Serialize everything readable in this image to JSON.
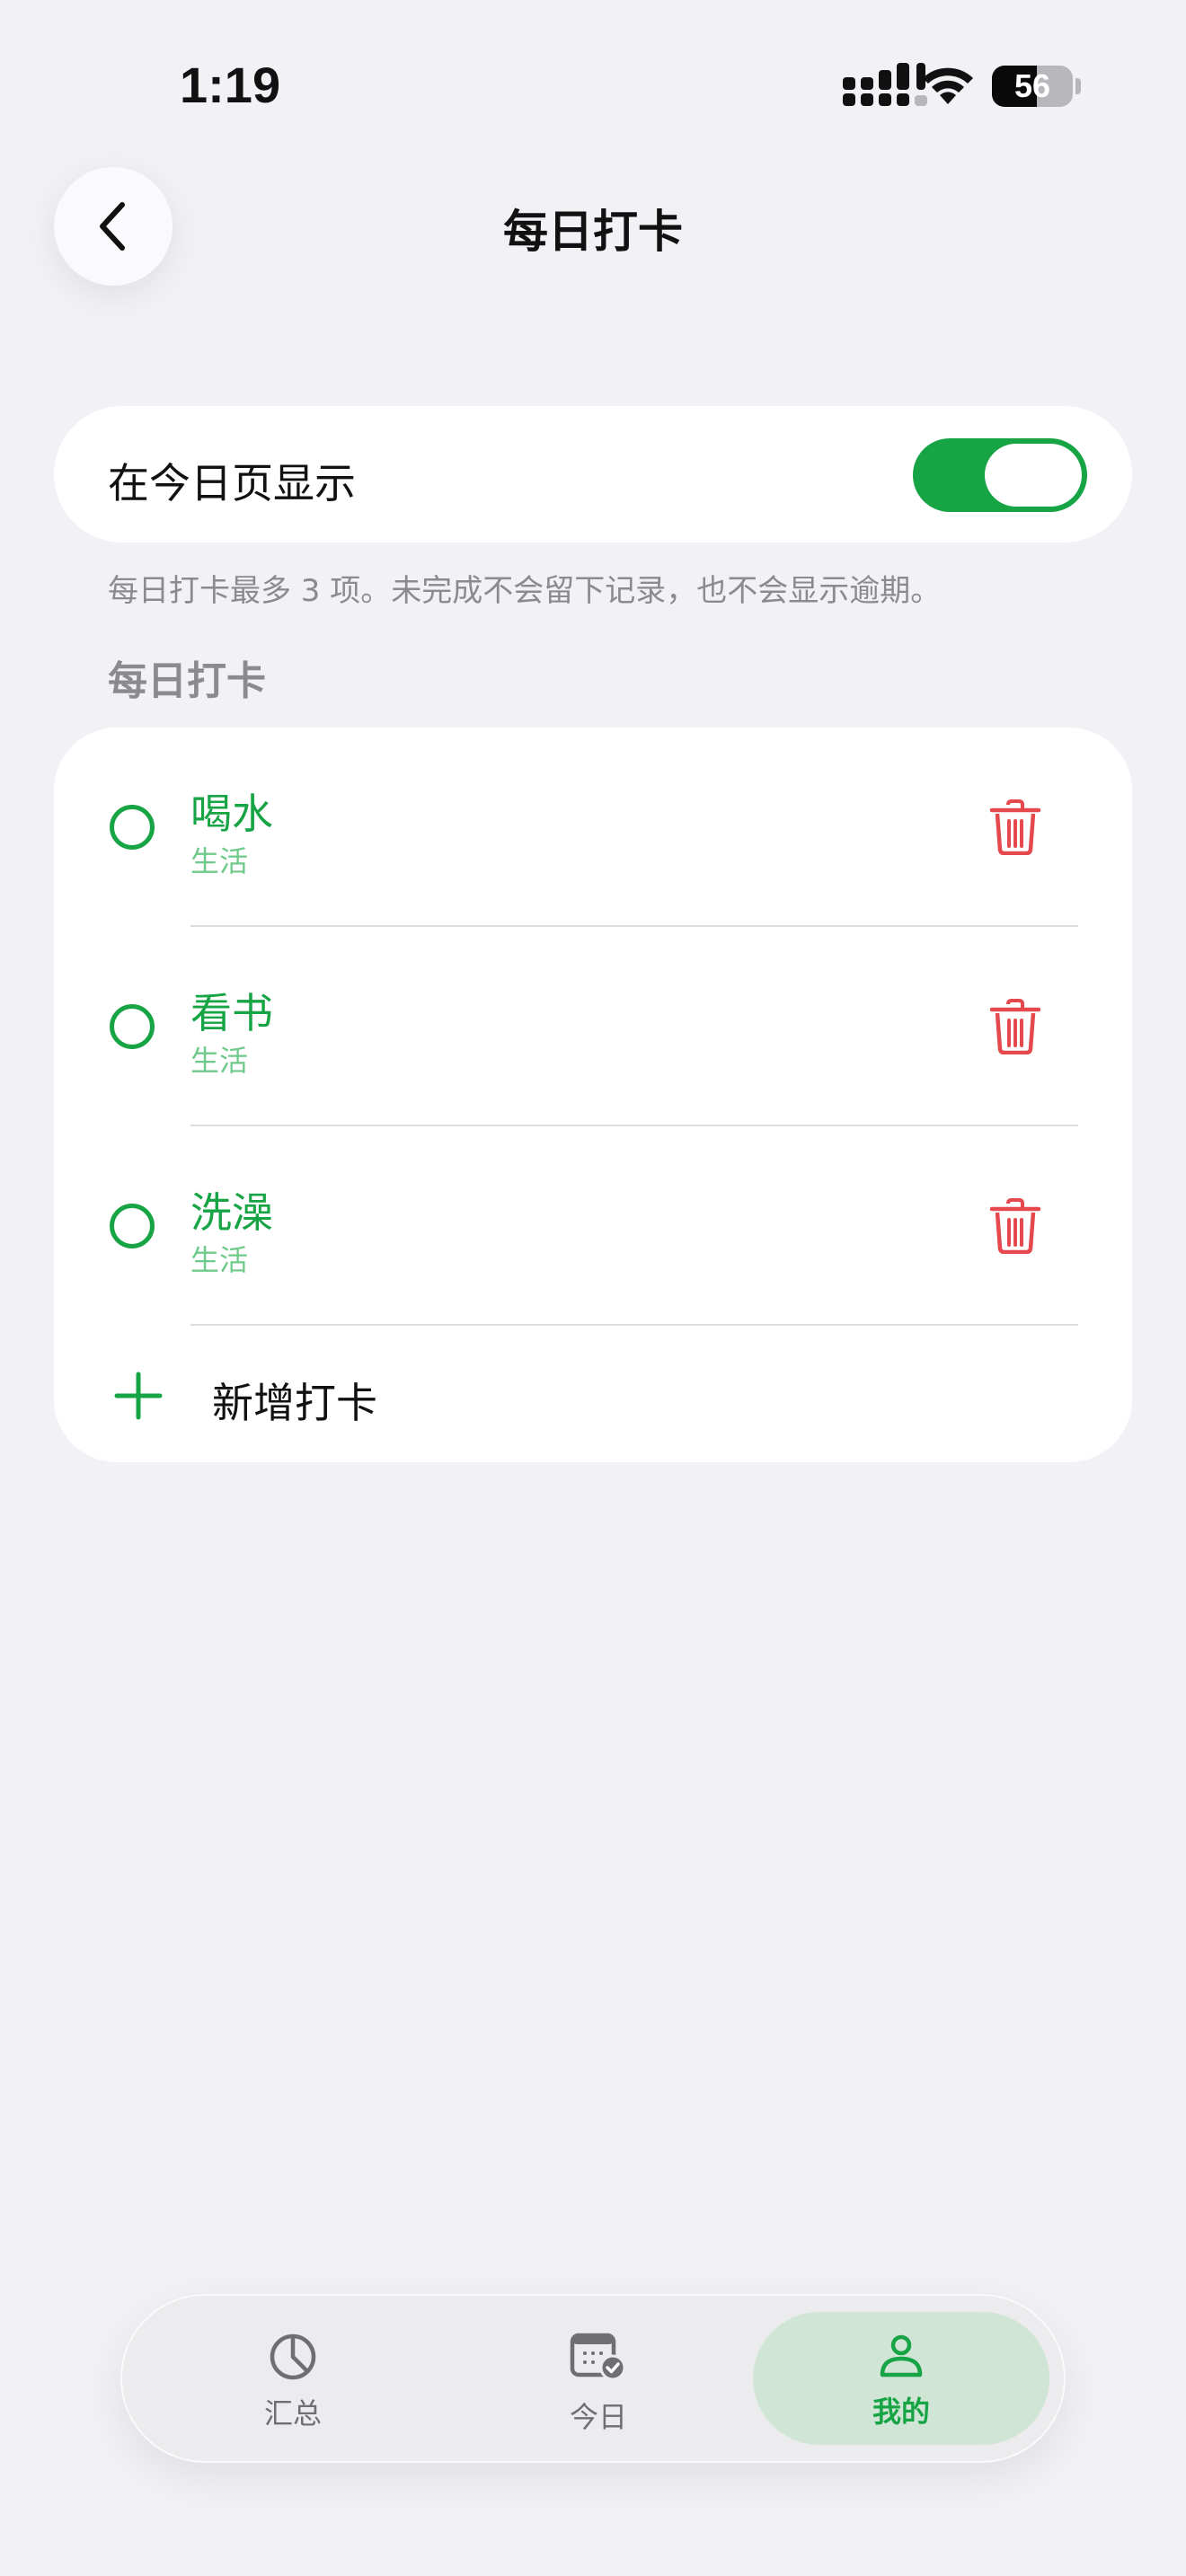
{
  "status_bar": {
    "time": "1:19",
    "battery": "56"
  },
  "header": {
    "title": "每日打卡"
  },
  "toggle_card": {
    "label": "在今日页显示",
    "enabled": true
  },
  "hint": "每日打卡最多 3 项。未完成不会留下记录，也不会显示逾期。",
  "section_title": "每日打卡",
  "habits": [
    {
      "name": "喝水",
      "category": "生活"
    },
    {
      "name": "看书",
      "category": "生活"
    },
    {
      "name": "洗澡",
      "category": "生活"
    }
  ],
  "add_label": "新增打卡",
  "tabs": [
    {
      "label": "汇总",
      "icon": "pie-chart-icon"
    },
    {
      "label": "今日",
      "icon": "calendar-check-icon"
    },
    {
      "label": "我的",
      "icon": "person-icon",
      "active": true
    }
  ],
  "colors": {
    "accent": "#17a444",
    "accent_light": "#6fc98a",
    "delete": "#e5484d",
    "background": "#f1f1f6",
    "active_tab_bg": "#d1e5d6"
  }
}
